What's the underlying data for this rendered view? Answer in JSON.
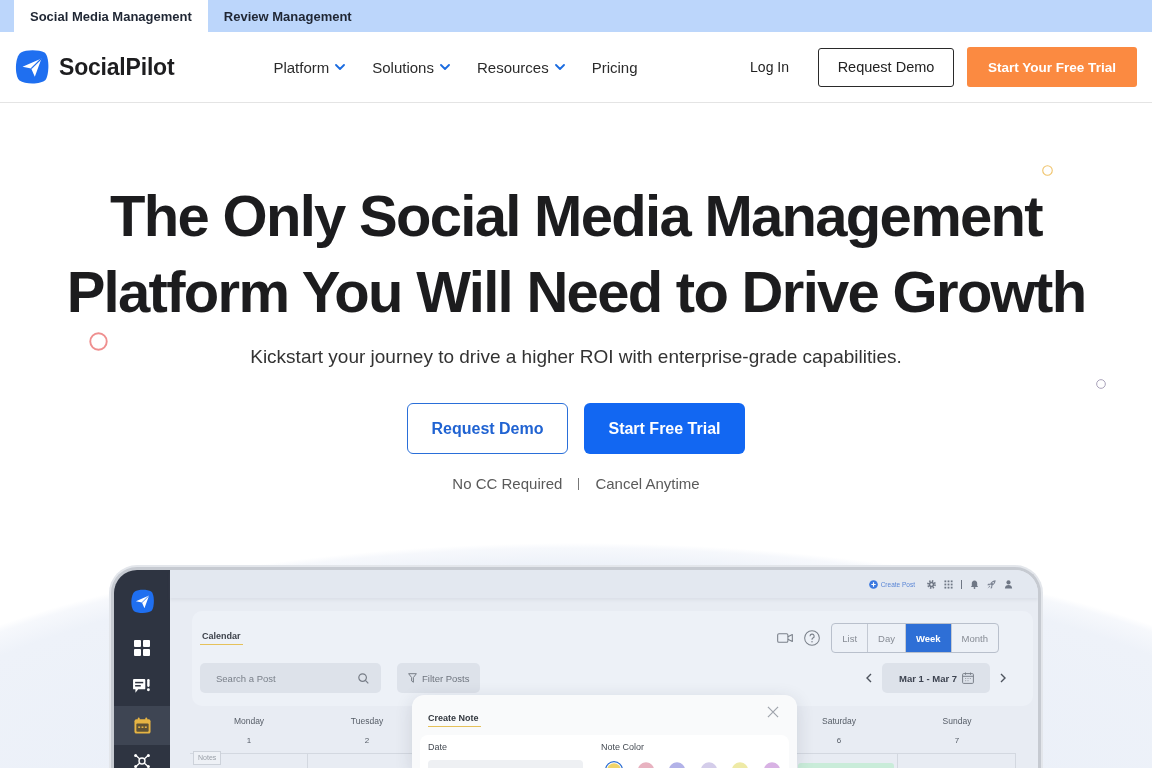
{
  "top_tabs": [
    {
      "label": "Social Media Management",
      "selected": true
    },
    {
      "label": "Review Management",
      "selected": false
    }
  ],
  "navbar": {
    "brand": "SocialPilot",
    "links": [
      {
        "label": "Platform",
        "has_menu": true
      },
      {
        "label": "Solutions",
        "has_menu": true
      },
      {
        "label": "Resources",
        "has_menu": true
      },
      {
        "label": "Pricing",
        "has_menu": false
      }
    ],
    "login": "Log In",
    "buttons": [
      {
        "label": "Request Demo",
        "kind": "outline"
      },
      {
        "label": "Start Your Free Trial",
        "kind": "primary"
      }
    ]
  },
  "hero": {
    "title_lines": [
      "The Only Social Media Management",
      "Platform You Will Need to Drive Growth"
    ],
    "subtitle": "Kickstart your journey to drive a higher ROI with enterprise-grade capabilities.",
    "buttons": [
      {
        "label": "Request Demo",
        "kind": "outline"
      },
      {
        "label": "Start Free Trial",
        "kind": "primary"
      }
    ],
    "notes": [
      "No CC Required",
      "Cancel Anytime"
    ]
  },
  "app_preview": {
    "create_post": "Create Post",
    "sidebar_items": [
      {
        "selected": false
      },
      {
        "selected": false
      },
      {
        "selected": true
      },
      {
        "selected": false
      }
    ],
    "page_tab": "Calendar",
    "view_tabs": [
      {
        "label": "List",
        "selected": false
      },
      {
        "label": "Day",
        "selected": false
      },
      {
        "label": "Week",
        "selected": true
      },
      {
        "label": "Month",
        "selected": false
      }
    ],
    "search": {
      "placeholder": "Search a Post"
    },
    "filter_button": "Filter Posts",
    "date_range": "Mar 1 - Mar 7",
    "days_left": [
      {
        "name": "Monday",
        "date": "1"
      },
      {
        "name": "Tuesday",
        "date": "2"
      }
    ],
    "days_right": [
      {
        "name": "Saturday",
        "date": "6"
      },
      {
        "name": "Sunday",
        "date": "7"
      }
    ],
    "notes_tag": "Notes",
    "note_dialog": {
      "title": "Create Note",
      "date_label": "Date",
      "color_label": "Note Color",
      "colors": [
        {
          "color": "#f0d46a",
          "selected": true
        },
        {
          "color": "#e8b2c0",
          "selected": false
        },
        {
          "color": "#b2b2e8",
          "selected": false
        },
        {
          "color": "#d4cdea",
          "selected": false
        },
        {
          "color": "#eeeaa6",
          "selected": false
        },
        {
          "color": "#d8b2e4",
          "selected": false
        }
      ]
    }
  }
}
